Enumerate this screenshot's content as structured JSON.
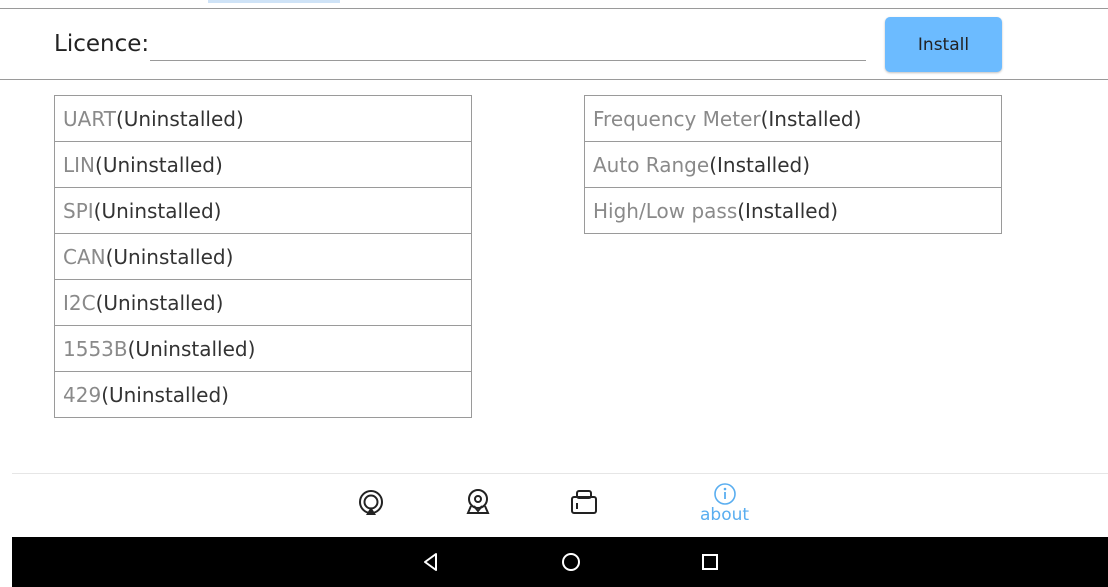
{
  "licence": {
    "label": "Licence:",
    "value": "",
    "placeholder": ""
  },
  "install_button": {
    "label": "Install"
  },
  "left_modules": [
    {
      "name": "UART",
      "status": "(Uninstalled)"
    },
    {
      "name": "LIN",
      "status": "(Uninstalled)"
    },
    {
      "name": "SPI",
      "status": "(Uninstalled)"
    },
    {
      "name": "CAN",
      "status": "(Uninstalled)"
    },
    {
      "name": "I2C",
      "status": "(Uninstalled)"
    },
    {
      "name": "1553B",
      "status": "(Uninstalled)"
    },
    {
      "name": "429",
      "status": "(Uninstalled)"
    }
  ],
  "right_modules": [
    {
      "name": "Frequency Meter",
      "status": "(Installed)"
    },
    {
      "name": "Auto Range",
      "status": "(Installed)"
    },
    {
      "name": "High/Low pass",
      "status": "(Installed)"
    }
  ],
  "bottom_nav": {
    "items": [
      {
        "icon": "oscilloscope-icon"
      },
      {
        "icon": "location-icon"
      },
      {
        "icon": "device-icon"
      },
      {
        "icon": "info-icon",
        "label": "about",
        "active": true
      }
    ]
  },
  "system_nav": {
    "items": [
      "back-icon",
      "home-icon",
      "recents-icon"
    ]
  },
  "colors": {
    "accent": "#5aaef0",
    "install_button": "#6cbbff"
  }
}
